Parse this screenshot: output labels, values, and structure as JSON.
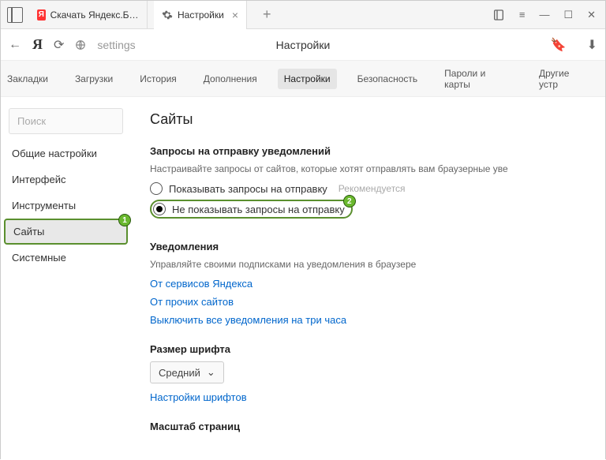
{
  "titlebar": {
    "tabs": [
      {
        "title": "Скачать Яндекс.Браузер д"
      },
      {
        "title": "Настройки"
      }
    ]
  },
  "addressbar": {
    "url": "settings",
    "page_title": "Настройки"
  },
  "topnav": {
    "items": [
      "Закладки",
      "Загрузки",
      "История",
      "Дополнения",
      "Настройки",
      "Безопасность",
      "Пароли и карты",
      "Другие устр"
    ]
  },
  "sidebar": {
    "search_placeholder": "Поиск",
    "items": [
      "Общие настройки",
      "Интерфейс",
      "Инструменты",
      "Сайты",
      "Системные"
    ]
  },
  "main": {
    "heading": "Сайты",
    "notif_req": {
      "title": "Запросы на отправку уведомлений",
      "desc": "Настраивайте запросы от сайтов, которые хотят отправлять вам браузерные уве",
      "opt1": "Показывать запросы на отправку",
      "opt1_rec": "Рекомендуется",
      "opt2": "Не показывать запросы на отправку"
    },
    "notif": {
      "title": "Уведомления",
      "desc": "Управляйте своими подписками на уведомления в браузере",
      "link1": "От сервисов Яндекса",
      "link2": "От прочих сайтов",
      "link3": "Выключить все уведомления на три часа"
    },
    "font": {
      "title": "Размер шрифта",
      "value": "Средний",
      "link": "Настройки шрифтов"
    },
    "zoom": {
      "title": "Масштаб страниц"
    }
  },
  "badges": {
    "b1": "1",
    "b2": "2"
  }
}
